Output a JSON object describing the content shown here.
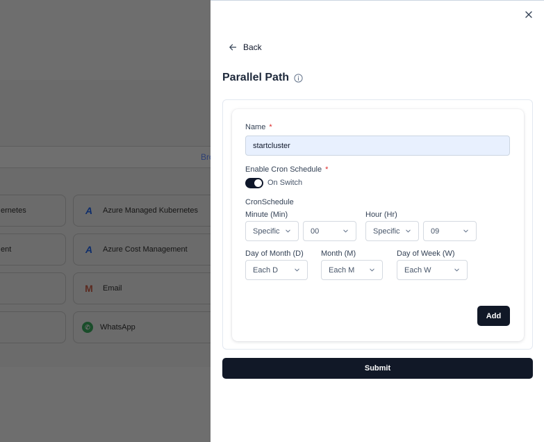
{
  "background": {
    "browse_link": "Bro",
    "cards": [
      {
        "label": "ernetes",
        "icon": "none"
      },
      {
        "label": "Azure Managed Kubernetes",
        "icon": "azure-icon"
      },
      {
        "label": "ent",
        "icon": "none"
      },
      {
        "label": "Azure Cost Management",
        "icon": "azure-icon"
      },
      {
        "label": "",
        "icon": "none"
      },
      {
        "label": "Email",
        "icon": "gmail-icon"
      },
      {
        "label": "",
        "icon": "none"
      },
      {
        "label": "WhatsApp",
        "icon": "whatsapp-icon"
      }
    ]
  },
  "drawer": {
    "back_label": "Back",
    "title": "Parallel Path",
    "form": {
      "name_label": "Name",
      "name_required": "*",
      "name_value": "startcluster",
      "cron_enable_label": "Enable Cron Schedule",
      "cron_enable_required": "*",
      "switch_label": "On Switch",
      "switch_on": true,
      "cron_schedule_label": "CronSchedule",
      "minute_label": "Minute (Min)",
      "minute_mode": "Specific",
      "minute_value": "00",
      "hour_label": "Hour (Hr)",
      "hour_mode": "Specific",
      "hour_value": "09",
      "dom_label": "Day of Month (D)",
      "dom_value": "Each D",
      "month_label": "Month (M)",
      "month_value": "Each M",
      "dow_label": "Day of Week (W)",
      "dow_value": "Each W",
      "add_label": "Add"
    },
    "submit_label": "Submit"
  },
  "colors": {
    "primary_button": "#111827",
    "required": "#dc2626",
    "input_fill": "#e8f0fe",
    "overlay": "#6b6b6b"
  }
}
